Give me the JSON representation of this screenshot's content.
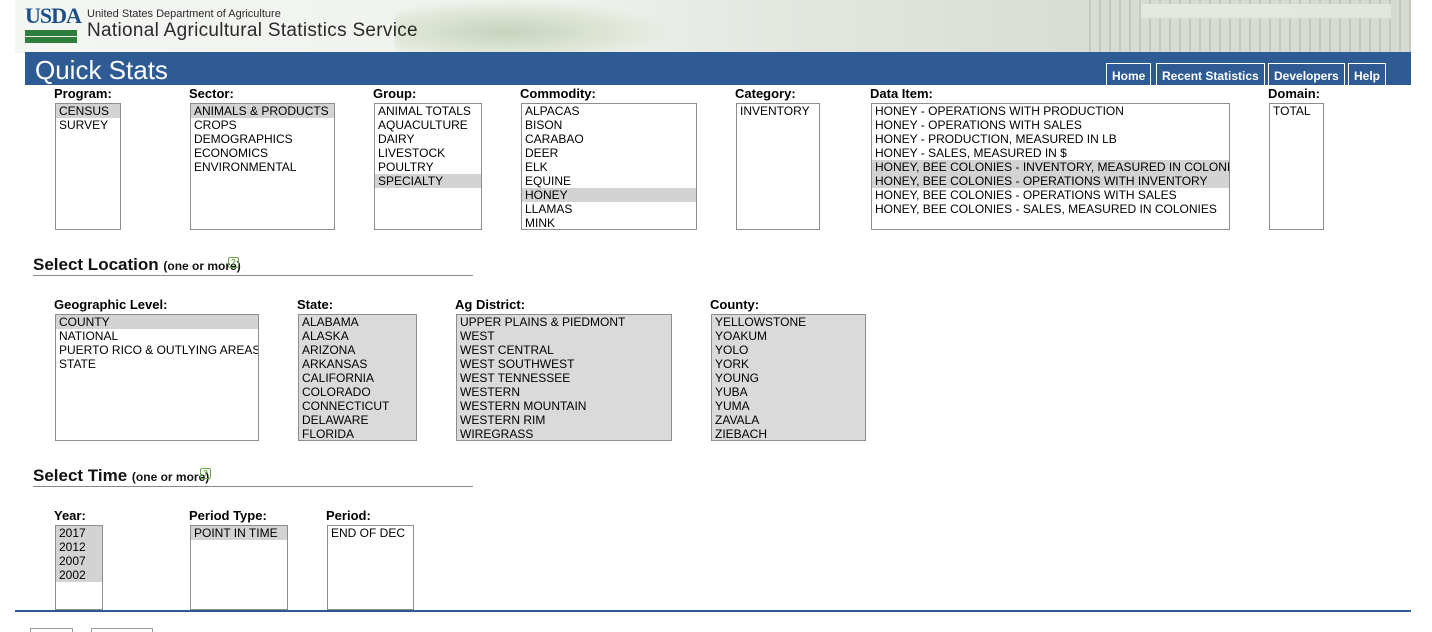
{
  "header": {
    "logo_text": "USDA",
    "agency_small": "United States Department of Agriculture",
    "agency_big": "National Agricultural Statistics Service"
  },
  "titlebar": {
    "title": "Quick Stats",
    "nav": [
      "Home",
      "Recent Statistics",
      "Developers",
      "Help"
    ]
  },
  "what": {
    "program": {
      "label": "Program:",
      "options": [
        "CENSUS",
        "SURVEY"
      ],
      "selected": [
        0
      ]
    },
    "sector": {
      "label": "Sector:",
      "options": [
        "ANIMALS & PRODUCTS",
        "CROPS",
        "DEMOGRAPHICS",
        "ECONOMICS",
        "ENVIRONMENTAL"
      ],
      "selected": [
        0
      ]
    },
    "group": {
      "label": "Group:",
      "options": [
        "ANIMAL TOTALS",
        "AQUACULTURE",
        "DAIRY",
        "LIVESTOCK",
        "POULTRY",
        "SPECIALTY"
      ],
      "selected": [
        5
      ]
    },
    "commodity": {
      "label": "Commodity:",
      "options": [
        "ALPACAS",
        "BISON",
        "CARABAO",
        "DEER",
        "ELK",
        "EQUINE",
        "HONEY",
        "LLAMAS",
        "MINK"
      ],
      "selected": [
        6
      ]
    },
    "category": {
      "label": "Category:",
      "options": [
        "INVENTORY"
      ],
      "selected": []
    },
    "data_item": {
      "label": "Data Item:",
      "options": [
        "HONEY - OPERATIONS WITH PRODUCTION",
        "HONEY - OPERATIONS WITH SALES",
        "HONEY - PRODUCTION, MEASURED IN LB",
        "HONEY - SALES, MEASURED IN $",
        "HONEY, BEE COLONIES - INVENTORY, MEASURED IN COLONIES",
        "HONEY, BEE COLONIES - OPERATIONS WITH INVENTORY",
        "HONEY, BEE COLONIES - OPERATIONS WITH SALES",
        "HONEY, BEE COLONIES - SALES, MEASURED IN COLONIES"
      ],
      "selected": [
        4,
        5
      ]
    },
    "domain": {
      "label": "Domain:",
      "options": [
        "TOTAL"
      ],
      "selected": []
    }
  },
  "location": {
    "title": "Select Location",
    "subtitle": "(one or more)",
    "geo_level": {
      "label": "Geographic Level:",
      "options": [
        "COUNTY",
        "NATIONAL",
        "PUERTO RICO & OUTLYING AREAS",
        "STATE"
      ],
      "selected": [
        0
      ]
    },
    "state": {
      "label": "State:",
      "options": [
        "ALABAMA",
        "ALASKA",
        "ARIZONA",
        "ARKANSAS",
        "CALIFORNIA",
        "COLORADO",
        "CONNECTICUT",
        "DELAWARE",
        "FLORIDA"
      ],
      "selected": []
    },
    "ag_district": {
      "label": "Ag District:",
      "options": [
        "UPPER PLAINS & PIEDMONT",
        "WEST",
        "WEST CENTRAL",
        "WEST SOUTHWEST",
        "WEST TENNESSEE",
        "WESTERN",
        "WESTERN MOUNTAIN",
        "WESTERN RIM",
        "WIREGRASS"
      ],
      "selected": []
    },
    "county": {
      "label": "County:",
      "options": [
        "YELLOWSTONE",
        "YOAKUM",
        "YOLO",
        "YORK",
        "YOUNG",
        "YUBA",
        "YUMA",
        "ZAVALA",
        "ZIEBACH"
      ],
      "selected": []
    }
  },
  "time": {
    "title": "Select Time",
    "subtitle": "(one or more)",
    "year": {
      "label": "Year:",
      "options": [
        "2017",
        "2012",
        "2007",
        "2002"
      ],
      "selected": [
        0,
        1,
        2,
        3
      ]
    },
    "period_type": {
      "label": "Period Type:",
      "options": [
        "POINT IN TIME"
      ],
      "selected": [
        0
      ]
    },
    "period": {
      "label": "Period:",
      "options": [
        "END OF DEC"
      ],
      "selected": []
    }
  },
  "colors": {
    "brand_blue": "#2f5b95",
    "selected_row": "#d3d3d3",
    "help_icon": "#69a64a"
  }
}
